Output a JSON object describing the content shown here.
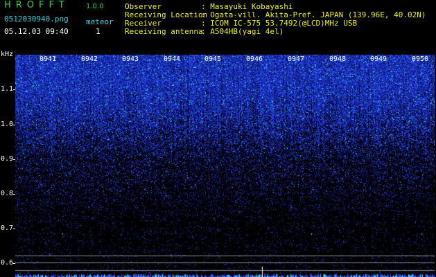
{
  "header": {
    "app_title": "HROFFT",
    "app_version": "1.0.0",
    "filename": "0512030940.png",
    "datetime": "05.12.03 09:40",
    "meteor_label": "meteor",
    "meteor_count": "1",
    "fields": [
      {
        "label": "Observer",
        "value": ": Masayuki Kobayashi"
      },
      {
        "label": "Receiving Location",
        "value": ": Ogata-vill. Akita-Pref. JAPAN (139.96E, 40.02N)"
      },
      {
        "label": "Receiver",
        "value": ": ICOM IC-575 53.7492(@LCD)MHz USB"
      },
      {
        "label": "Receiving antenna",
        "value": ": A504HB(yagi 4el)"
      }
    ]
  },
  "spectrogram": {
    "unit_label": "kHz",
    "freq_ticks": [
      "1.1",
      "1.0",
      "0.9",
      "0.8",
      "0.7",
      "0.6"
    ],
    "time_ticks": [
      "0941",
      "0942",
      "0943",
      "0944",
      "0945",
      "0946",
      "0947",
      "0948",
      "0949",
      "0950"
    ],
    "colors": {
      "noise_bright": "#3050ff",
      "noise_dim": "#102090",
      "speck": "#40d0ff",
      "reference_lines": "#c8c8c8"
    }
  }
}
